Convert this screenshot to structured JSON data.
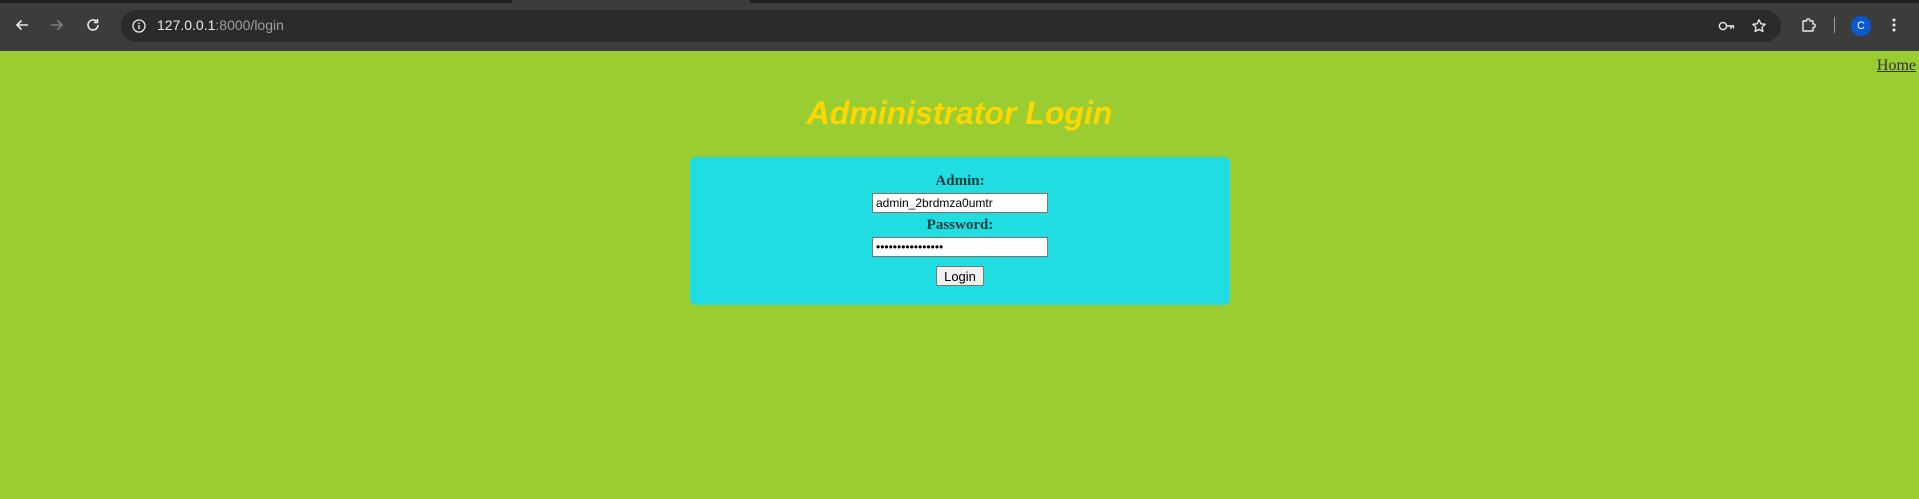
{
  "browser": {
    "url_host": "127.0.0.1",
    "url_rest": ":8000/login",
    "profile_initial": "C",
    "icons": {
      "back": "back-arrow-icon",
      "forward": "forward-arrow-icon",
      "reload": "reload-icon",
      "site_info": "info-icon",
      "password": "key-icon",
      "bookmark": "star-icon",
      "extensions": "puzzle-icon",
      "menu": "kebab-menu-icon"
    }
  },
  "page": {
    "home_link": "Home",
    "title": "Administrator Login",
    "form": {
      "admin_label": "Admin:",
      "admin_value": "admin_2brdmza0umtr",
      "password_label": "Password:",
      "password_value": "••••••••••••••••",
      "login_button": "Login"
    }
  },
  "colors": {
    "page_background": "#9acd32",
    "title_color": "#ffd700",
    "box_background": "#20dde2"
  }
}
